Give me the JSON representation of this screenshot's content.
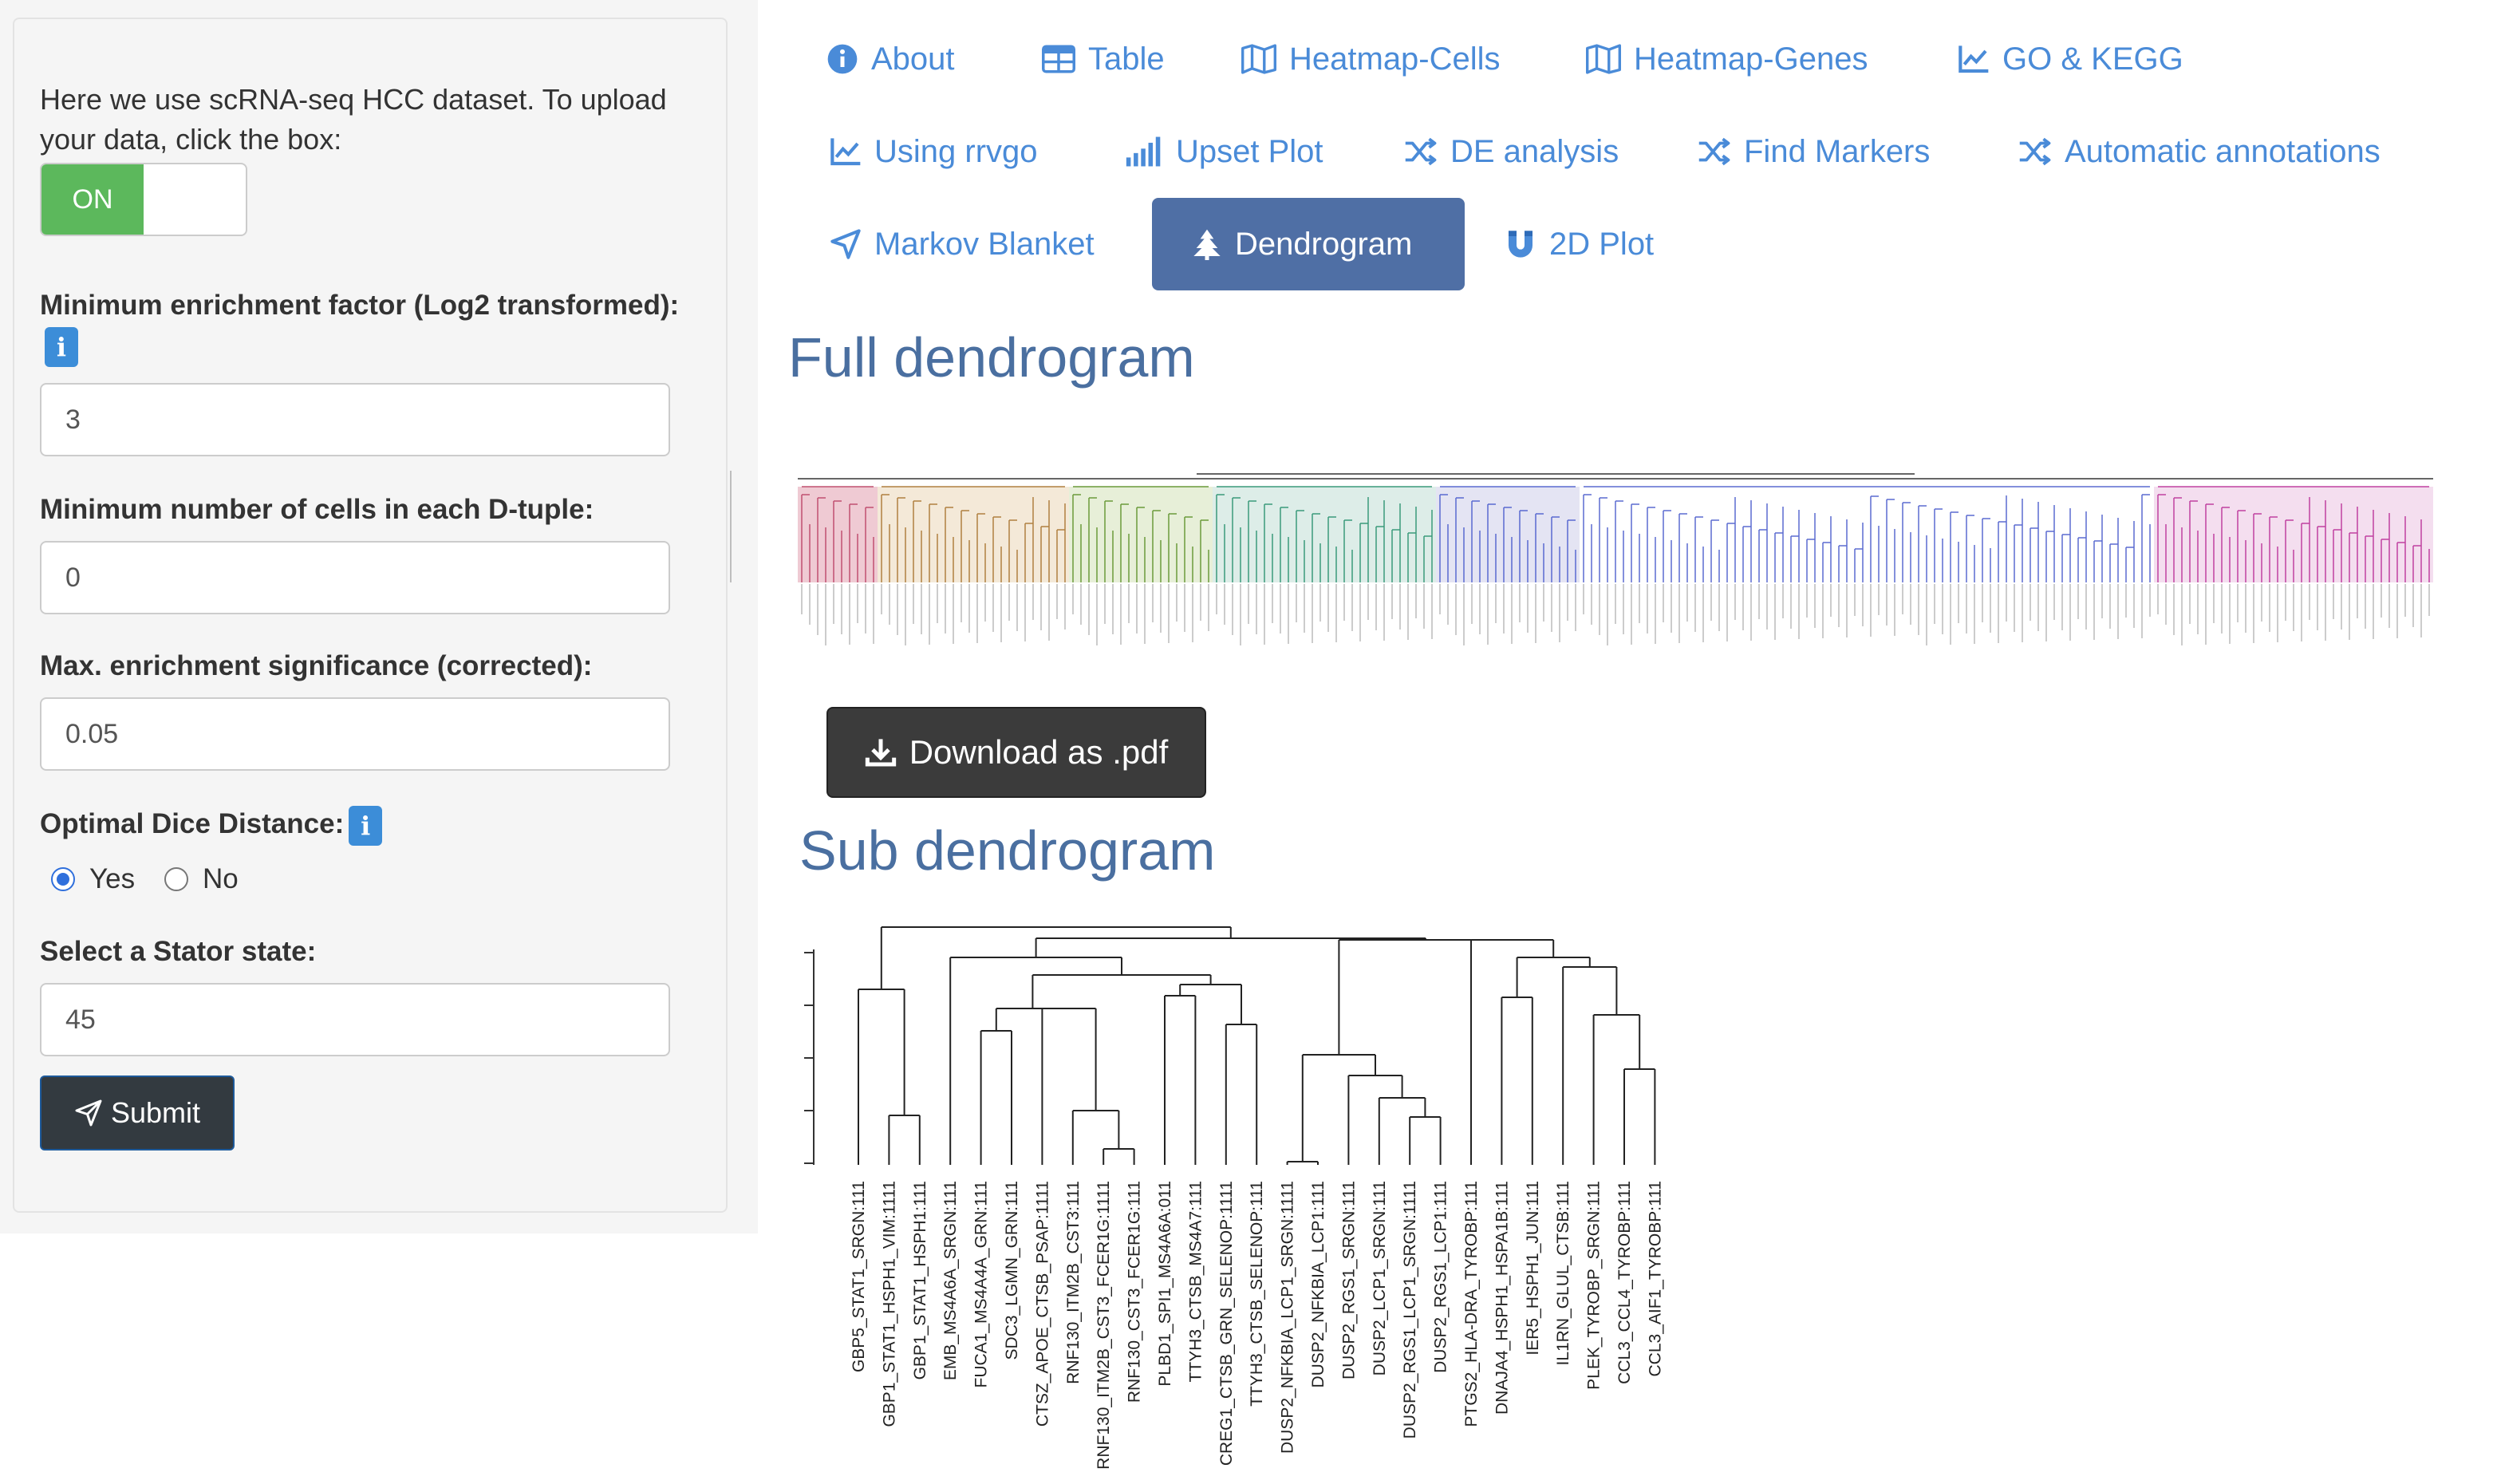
{
  "sidebar": {
    "intro_text": "Here we use scRNA-seq HCC dataset. To upload your data, click the box:",
    "toggle_on_label": "ON",
    "min_enrichment_label": "Minimum enrichment factor (Log2 transformed):",
    "min_enrichment_value": "3",
    "min_cells_label": "Minimum number of cells in each D-tuple:",
    "min_cells_value": "0",
    "max_significance_label": "Max. enrichment significance (corrected):",
    "max_significance_value": "0.05",
    "dice_label": "Optimal Dice Distance:",
    "dice_yes": "Yes",
    "dice_no": "No",
    "dice_selected": "Yes",
    "stator_label": "Select a Stator state:",
    "stator_value": "45",
    "submit_label": "Submit",
    "info_glyph": "i"
  },
  "tabs": [
    {
      "label": "About",
      "icon": "info-circle-icon"
    },
    {
      "label": "Table",
      "icon": "table-icon"
    },
    {
      "label": "Heatmap-Cells",
      "icon": "map-icon"
    },
    {
      "label": "Heatmap-Genes",
      "icon": "map-icon"
    },
    {
      "label": "GO & KEGG",
      "icon": "line-chart-icon"
    },
    {
      "label": "Using rrvgo",
      "icon": "line-chart-icon"
    },
    {
      "label": "Upset Plot",
      "icon": "signal-bars-icon"
    },
    {
      "label": "DE analysis",
      "icon": "shuffle-icon"
    },
    {
      "label": "Find Markers",
      "icon": "shuffle-icon"
    },
    {
      "label": "Automatic annotations",
      "icon": "shuffle-icon"
    },
    {
      "label": "Markov Blanket",
      "icon": "share-icon"
    },
    {
      "label": "Dendrogram",
      "icon": "tree-icon",
      "active": true
    },
    {
      "label": "2D Plot",
      "icon": "magnet-icon"
    }
  ],
  "main": {
    "full_title": "Full dendrogram",
    "download_label": "Download as .pdf",
    "sub_title": "Sub dendrogram"
  },
  "sub_dendrogram_leaves": [
    "GBP5_STAT1_SRGN:111",
    "GBP1_STAT1_HSPH1_VIM:1111",
    "GBP1_STAT1_HSPH1:111",
    "EMB_MS4A6A_SRGN:111",
    "FUCA1_MS4A4A_GRN:111",
    "SDC3_LGMN_GRN:111",
    "CTSZ_APOE_CTSB_PSAP:1111",
    "RNF130_ITM2B_CST3:111",
    "RNF130_ITM2B_CST3_FCER1G:1111",
    "RNF130_CST3_FCER1G:111",
    "PLBD1_SPI1_MS4A6A:011",
    "TTYH3_CTSB_MS4A7:111",
    "CREG1_CTSB_GRN_SELENOP:1111",
    "TTYH3_CTSB_SELENOP:111",
    "DUSP2_NFKBIA_LCP1_SRGN:1111",
    "DUSP2_NFKBIA_LCP1:111",
    "DUSP2_RGS1_SRGN:111",
    "DUSP2_LCP1_SRGN:111",
    "DUSP2_RGS1_LCP1_SRGN:1111",
    "DUSP2_RGS1_LCP1:111",
    "PTGS2_HLA-DRA_TYROBP:111",
    "DNAJA4_HSPH1_HSPA1B:111",
    "IER5_HSPH1_JUN:111",
    "IL1RN_GLUL_CTSB:111",
    "PLEK_TYROBP_SRGN:111",
    "CCL3_CCL4_TYROBP:111",
    "CCL3_AIF1_TYROBP:111"
  ],
  "colors": {
    "accent": "#4a8bd8",
    "active_tab": "#4f6fa5",
    "heading": "#4a6fa0",
    "toggle_on": "#5cb85c",
    "download_btn": "#3b3b3b",
    "submit_btn": "#333a40"
  }
}
